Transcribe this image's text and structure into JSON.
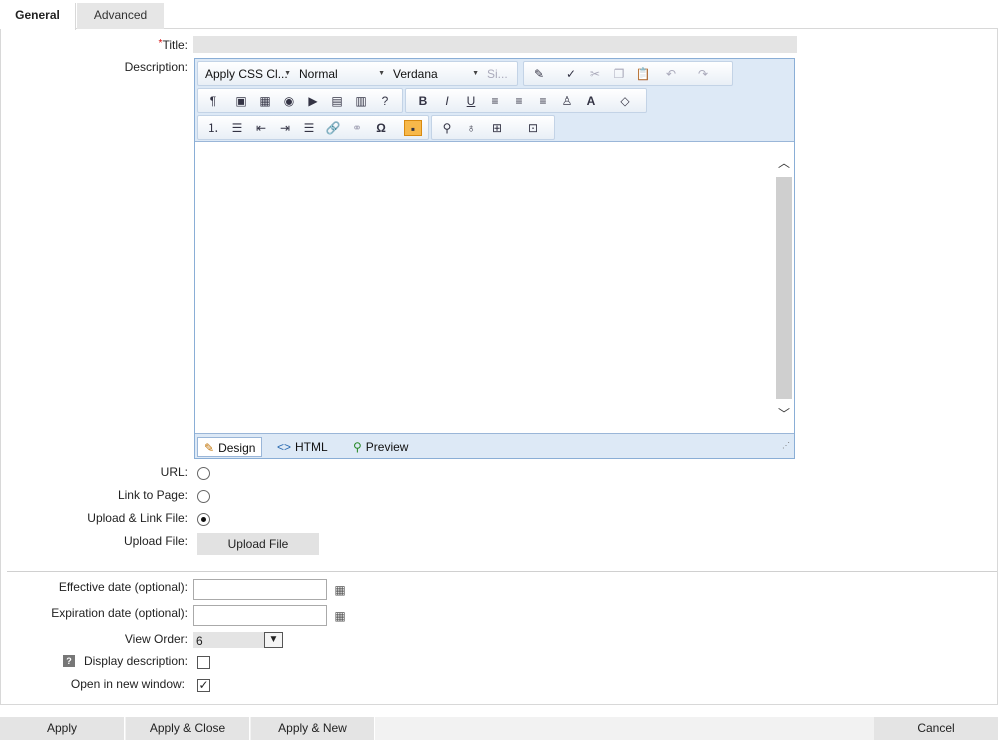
{
  "tabs": [
    {
      "label": "General",
      "active": true
    },
    {
      "label": "Advanced",
      "active": false
    }
  ],
  "form": {
    "title_label": "Title:",
    "title_required": "*",
    "title_value": "",
    "description_label": "Description:",
    "url_label": "URL:",
    "link_to_page_label": "Link to Page:",
    "upload_link_label": "Upload & Link File:",
    "upload_file_label": "Upload File:",
    "upload_button": "Upload File",
    "effective_label": "Effective date (optional):",
    "expiration_label": "Expiration date (optional):",
    "view_order_label": "View Order:",
    "view_order_value": "6",
    "display_desc_label": "Display description:",
    "open_new_label": "Open in new window:",
    "help_glyph": "?"
  },
  "editor": {
    "css_class_dd": "Apply CSS Cl...",
    "paragraph_dd": "Normal",
    "font_dd": "Verdana",
    "size_dd": "Si...",
    "modes": {
      "design": "Design",
      "html": "HTML",
      "preview": "Preview"
    }
  },
  "footer": {
    "apply": "Apply",
    "apply_close": "Apply & Close",
    "apply_new": "Apply & New",
    "cancel": "Cancel"
  },
  "colors": {
    "editor_bg": "#dde9f6",
    "editor_border": "#8aaed6",
    "tab_inactive": "#e6e6e6",
    "button_gray": "#e2e2e2",
    "selected_tool": "#f7b84a"
  }
}
